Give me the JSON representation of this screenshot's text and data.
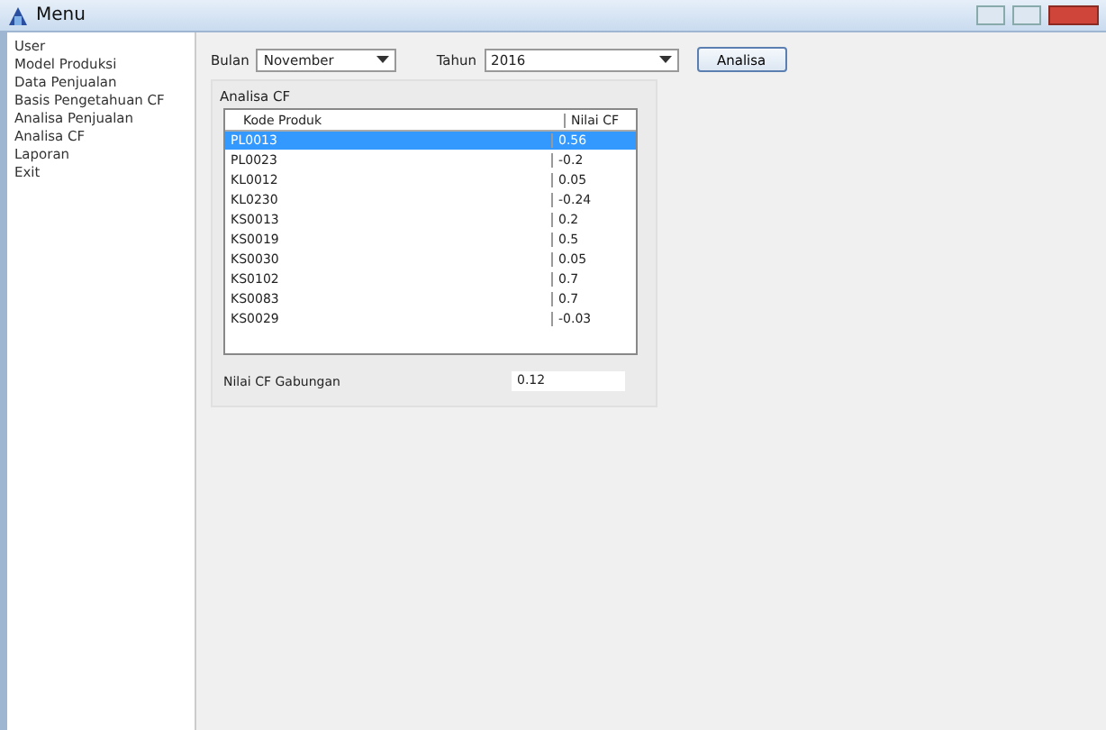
{
  "window": {
    "title": "Menu"
  },
  "sidebar": {
    "items": [
      {
        "label": "User"
      },
      {
        "label": "Model Produksi"
      },
      {
        "label": "Data Penjualan"
      },
      {
        "label": "Basis Pengetahuan CF"
      },
      {
        "label": "Analisa Penjualan"
      },
      {
        "label": "Analisa CF"
      },
      {
        "label": "Laporan"
      },
      {
        "label": "Exit"
      }
    ]
  },
  "filters": {
    "month_label": "Bulan",
    "month": "November",
    "year_label": "Tahun",
    "year": "2016",
    "button": "Analisa"
  },
  "group": {
    "title": "Analisa CF",
    "columns": [
      "Kode Produk",
      "Nilai CF"
    ],
    "rows": [
      {
        "cells": [
          "PL0013",
          "0.56"
        ],
        "selected": true
      },
      {
        "cells": [
          "PL0023",
          "-0.2"
        ],
        "selected": false
      },
      {
        "cells": [
          "KL0012",
          "0.05"
        ],
        "selected": false
      },
      {
        "cells": [
          "KL0230",
          "-0.24"
        ],
        "selected": false
      },
      {
        "cells": [
          "KS0013",
          "0.2"
        ],
        "selected": false
      },
      {
        "cells": [
          "KS0019",
          "0.5"
        ],
        "selected": false
      },
      {
        "cells": [
          "KS0030",
          "0.05"
        ],
        "selected": false
      },
      {
        "cells": [
          "KS0102",
          "0.7"
        ],
        "selected": false
      },
      {
        "cells": [
          "KS0083",
          "0.7"
        ],
        "selected": false
      },
      {
        "cells": [
          "KS0029",
          "-0.03"
        ],
        "selected": false
      }
    ],
    "total_label": "Nilai CF Gabungan",
    "total": "0.12"
  }
}
